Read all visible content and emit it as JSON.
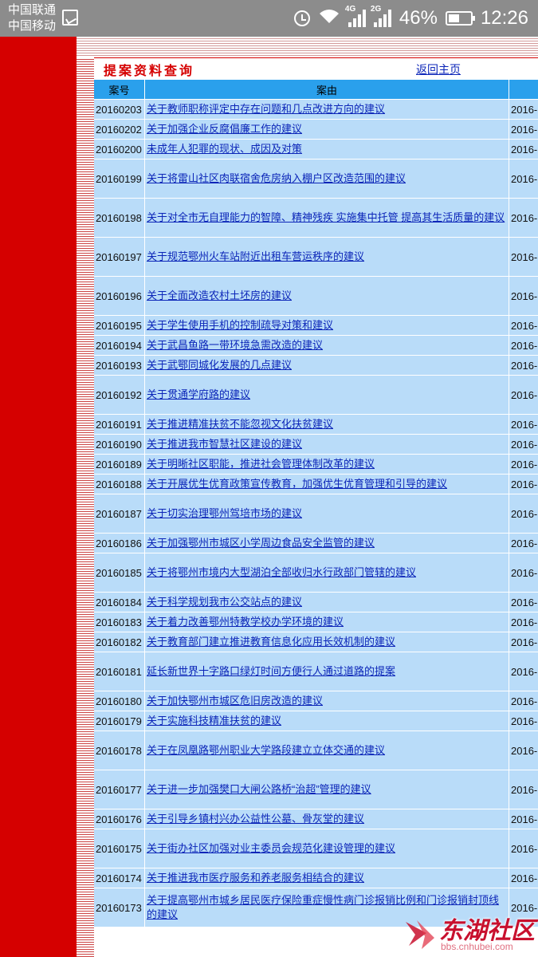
{
  "status_bar": {
    "carrier1": "中国联通",
    "carrier2": "中国移动",
    "net1": "4G",
    "net2": "2G",
    "battery": "46%",
    "time": "12:26"
  },
  "page": {
    "title": "提案资料查询",
    "home_link": "返回主页"
  },
  "table": {
    "headers": [
      "案号",
      "案由"
    ],
    "date_prefix": "2016-",
    "rows": [
      {
        "no": "20160203",
        "reason": "关于教师职称评定中存在问题和几点改进方向的建议"
      },
      {
        "no": "20160202",
        "reason": "关于加强企业反腐倡廉工作的建议"
      },
      {
        "no": "20160200",
        "reason": "未成年人犯罪的现状、成因及对策"
      },
      {
        "no": "20160199",
        "reason": "关于将雷山社区肉联宿舍危房纳入棚户区改造范围的建议"
      },
      {
        "no": "20160198",
        "reason": "关于对全市无自理能力的智障、精神残疾 实施集中托管 提高其生活质量的建议"
      },
      {
        "no": "20160197",
        "reason": "关于规范鄂州火车站附近出租车营运秩序的建议"
      },
      {
        "no": "20160196",
        "reason": "关于全面改造农村土坯房的建议"
      },
      {
        "no": "20160195",
        "reason": "关于学生使用手机的控制疏导对策和建议"
      },
      {
        "no": "20160194",
        "reason": "关于武昌鱼路一带环境急需改造的建议"
      },
      {
        "no": "20160193",
        "reason": "关于武鄂同城化发展的几点建议"
      },
      {
        "no": "20160192",
        "reason": "关于贯通学府路的建议"
      },
      {
        "no": "20160191",
        "reason": "关于推进精准扶贫不能忽视文化扶贫建议"
      },
      {
        "no": "20160190",
        "reason": "关于推进我市智慧社区建设的建议"
      },
      {
        "no": "20160189",
        "reason": "关于明晰社区职能，推进社会管理体制改革的建议"
      },
      {
        "no": "20160188",
        "reason": "关于开展优生优育政策宣传教育，加强优生优育管理和引导的建议"
      },
      {
        "no": "20160187",
        "reason": "关于切实治理鄂州驾培市场的建议"
      },
      {
        "no": "20160186",
        "reason": "关于加强鄂州市城区小学周边食品安全监管的建议"
      },
      {
        "no": "20160185",
        "reason": "关于将鄂州市境内大型湖泊全部收归水行政部门管辖的建议"
      },
      {
        "no": "20160184",
        "reason": "关于科学规划我市公交站点的建议"
      },
      {
        "no": "20160183",
        "reason": "关于着力改善鄂州特教学校办学环境的建议"
      },
      {
        "no": "20160182",
        "reason": "关于教育部门建立推进教育信息化应用长效机制的建议"
      },
      {
        "no": "20160181",
        "reason": "延长新世界十字路口绿灯时间方便行人通过道路的提案"
      },
      {
        "no": "20160180",
        "reason": "关于加快鄂州市城区危旧房改造的建议"
      },
      {
        "no": "20160179",
        "reason": "关于实施科技精准扶贫的建议"
      },
      {
        "no": "20160178",
        "reason": "关于在凤凰路鄂州职业大学路段建立立体交通的建议"
      },
      {
        "no": "20160177",
        "reason": "关于进一步加强樊口大闸公路桥“治超”管理的建议"
      },
      {
        "no": "20160176",
        "reason": "关于引导乡镇村兴办公益性公墓、骨灰堂的建议"
      },
      {
        "no": "20160175",
        "reason": "关于街办社区加强对业主委员会规范化建设管理的建议"
      },
      {
        "no": "20160174",
        "reason": "关于推进我市医疗服务和养老服务相结合的建议"
      },
      {
        "no": "20160173",
        "reason": "关于提高鄂州市城乡居民医疗保险重症慢性病门诊报销比例和门诊报销封顶线的建议"
      }
    ]
  },
  "watermark": {
    "text": "东湖社区",
    "url": "bbs.cnhubei.com"
  }
}
